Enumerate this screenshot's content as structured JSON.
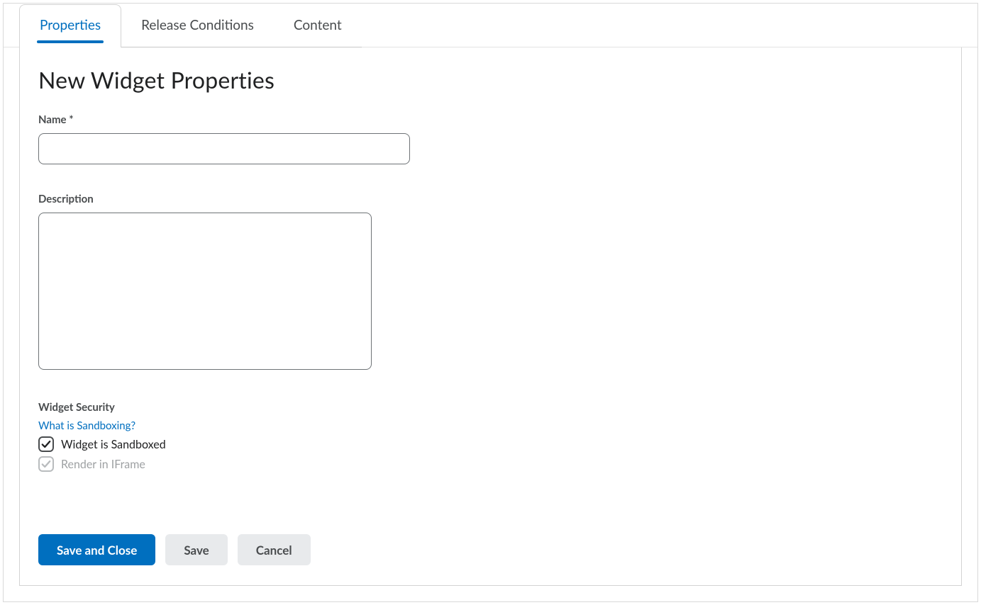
{
  "tabs": [
    {
      "label": "Properties",
      "active": true
    },
    {
      "label": "Release Conditions",
      "active": false
    },
    {
      "label": "Content",
      "active": false
    }
  ],
  "page_title": "New Widget Properties",
  "fields": {
    "name": {
      "label": "Name *",
      "value": ""
    },
    "description": {
      "label": "Description",
      "value": ""
    }
  },
  "security": {
    "heading": "Widget Security",
    "help_link": "What is Sandboxing?",
    "checkboxes": [
      {
        "label": "Widget is Sandboxed",
        "checked": true,
        "disabled": false
      },
      {
        "label": "Render in IFrame",
        "checked": true,
        "disabled": true
      }
    ]
  },
  "buttons": {
    "save_close": "Save and Close",
    "save": "Save",
    "cancel": "Cancel"
  }
}
